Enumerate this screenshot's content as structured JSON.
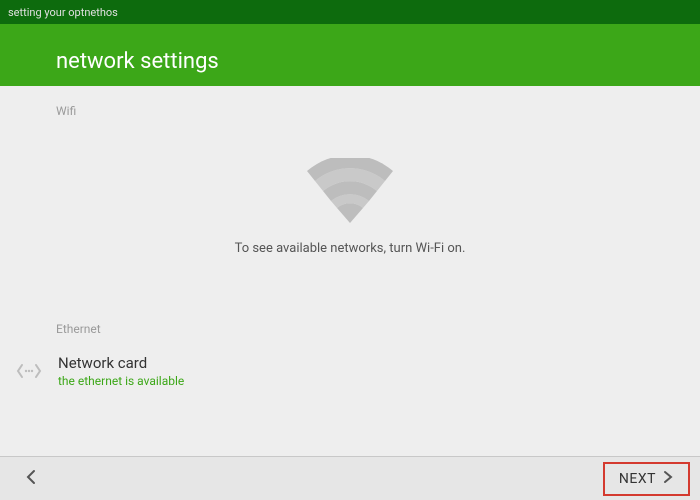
{
  "topbar": {
    "text": "setting your optnethos"
  },
  "header": {
    "title": "network settings"
  },
  "wifi": {
    "section_label": "Wifi",
    "message": "To see available networks, turn Wi-Fi on."
  },
  "ethernet": {
    "section_label": "Ethernet",
    "title": "Network card",
    "status": "the ethernet is available"
  },
  "footer": {
    "next_label": "NEXT"
  },
  "colors": {
    "topbar_bg": "#0d6b0d",
    "header_bg": "#3ca718",
    "accent_green": "#3ca718",
    "highlight_red": "#d43a2f"
  }
}
